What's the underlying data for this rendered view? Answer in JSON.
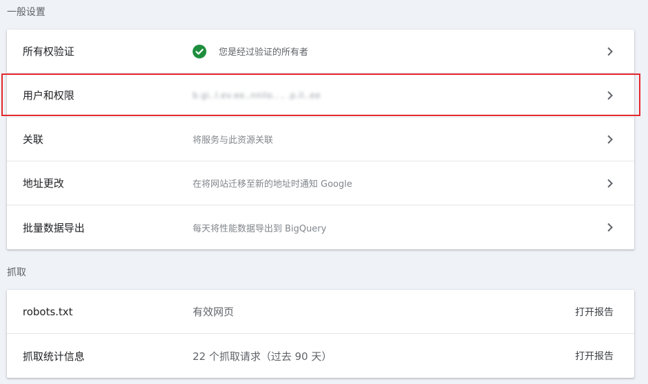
{
  "sections": {
    "general": {
      "title": "一般设置",
      "rows": [
        {
          "label": "所有权验证",
          "desc": "您是经过验证的所有者",
          "icon": "check-circle-icon"
        },
        {
          "label": "用户和权限",
          "desc": "b.gi..l.ev.ee..nnilo.. , .p.il..ee"
        },
        {
          "label": "关联",
          "desc": "将服务与此资源关联"
        },
        {
          "label": "地址更改",
          "desc": "在将网站迁移至新的地址时通知 Google"
        },
        {
          "label": "批量数据导出",
          "desc": "每天将性能数据导出到 BigQuery"
        }
      ]
    },
    "crawl": {
      "title": "抓取",
      "rows": [
        {
          "label": "robots.txt",
          "value": "有效网页",
          "action": "打开报告"
        },
        {
          "label": "抓取统计信息",
          "value": "22 个抓取请求（过去 90 天）",
          "action": "打开报告"
        }
      ]
    }
  },
  "colors": {
    "check": "#1e8e3e",
    "highlight": "#e3272c",
    "background": "#eff2f7"
  }
}
